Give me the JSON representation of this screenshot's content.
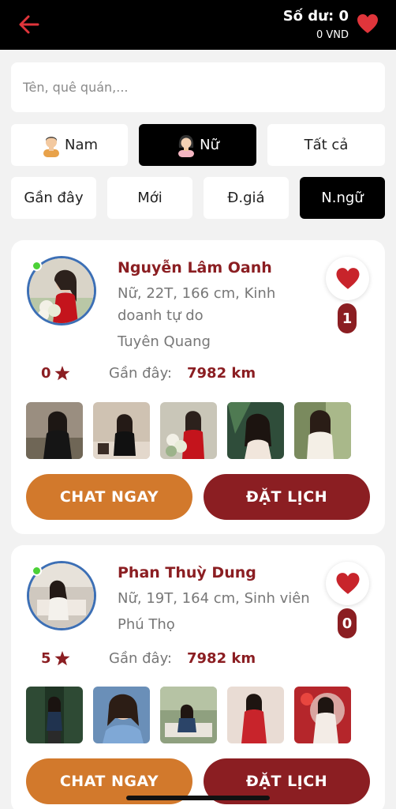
{
  "header": {
    "balance_title": "Số dư: 0",
    "balance_amount": "0 VND",
    "accent": "#e0353b"
  },
  "search": {
    "placeholder": "Tên, quê quán,..."
  },
  "gender_filters": [
    {
      "label": "Nam",
      "icon": "male-avatar-icon",
      "active": false
    },
    {
      "label": "Nữ",
      "icon": "female-avatar-icon",
      "active": true
    },
    {
      "label": "Tất cả",
      "active": false
    }
  ],
  "sort_filters": [
    {
      "label": "Gần đây",
      "active": false
    },
    {
      "label": "Mới",
      "active": false
    },
    {
      "label": "Đ.giá",
      "active": false
    },
    {
      "label": "N.ngữ",
      "active": true
    }
  ],
  "profiles": [
    {
      "name": "Nguyễn Lâm Oanh",
      "info": "Nữ, 22T, 166 cm, Kinh doanh tự do",
      "town": "Tuyên Quang",
      "likes": "1",
      "rating": "0",
      "distance_label": "Gần đây:",
      "distance": "7982 km",
      "online": true,
      "chat_label": "CHAT NGAY",
      "book_label": "ĐẶT LỊCH"
    },
    {
      "name": "Phan Thuỳ Dung",
      "info": "Nữ, 19T, 164 cm, Sinh viên",
      "town": "Phú Thọ",
      "likes": "0",
      "rating": "5",
      "distance_label": "Gần đây:",
      "distance": "7982 km",
      "online": true,
      "chat_label": "CHAT NGAY",
      "book_label": "ĐẶT LỊCH"
    }
  ],
  "colors": {
    "brand_red": "#8b1e22",
    "chat_orange": "#d2792c",
    "online_green": "#4cd137",
    "avatar_ring": "#3c6fb5"
  }
}
